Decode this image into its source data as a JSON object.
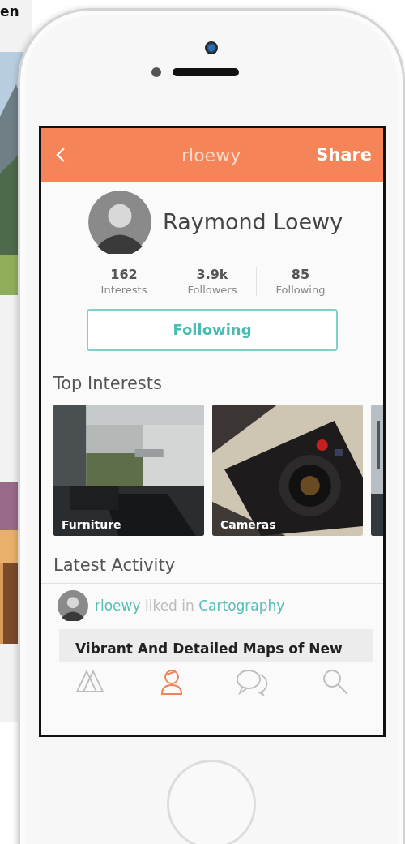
{
  "background_text": "en",
  "header": {
    "title": "rloewy",
    "action": "Share"
  },
  "profile": {
    "name": "Raymond Loewy",
    "stats": [
      {
        "value": "162",
        "label": "Interests"
      },
      {
        "value": "3.9k",
        "label": "Followers"
      },
      {
        "value": "85",
        "label": "Following"
      }
    ],
    "follow_button": "Following"
  },
  "top_interests": {
    "title": "Top Interests",
    "cards": [
      {
        "label": "Furniture",
        "kind": "room"
      },
      {
        "label": "Cameras",
        "kind": "camera"
      }
    ]
  },
  "latest_activity": {
    "title": "Latest Activity",
    "items": [
      {
        "user": "rloewy",
        "action": "liked in",
        "topic": "Cartography",
        "headline": "Vibrant And Detailed Maps of New"
      }
    ]
  },
  "tab_bar": [
    {
      "kind": "home",
      "selected": false
    },
    {
      "kind": "profile",
      "selected": true
    },
    {
      "kind": "chat",
      "selected": false
    },
    {
      "kind": "search",
      "selected": false
    }
  ]
}
